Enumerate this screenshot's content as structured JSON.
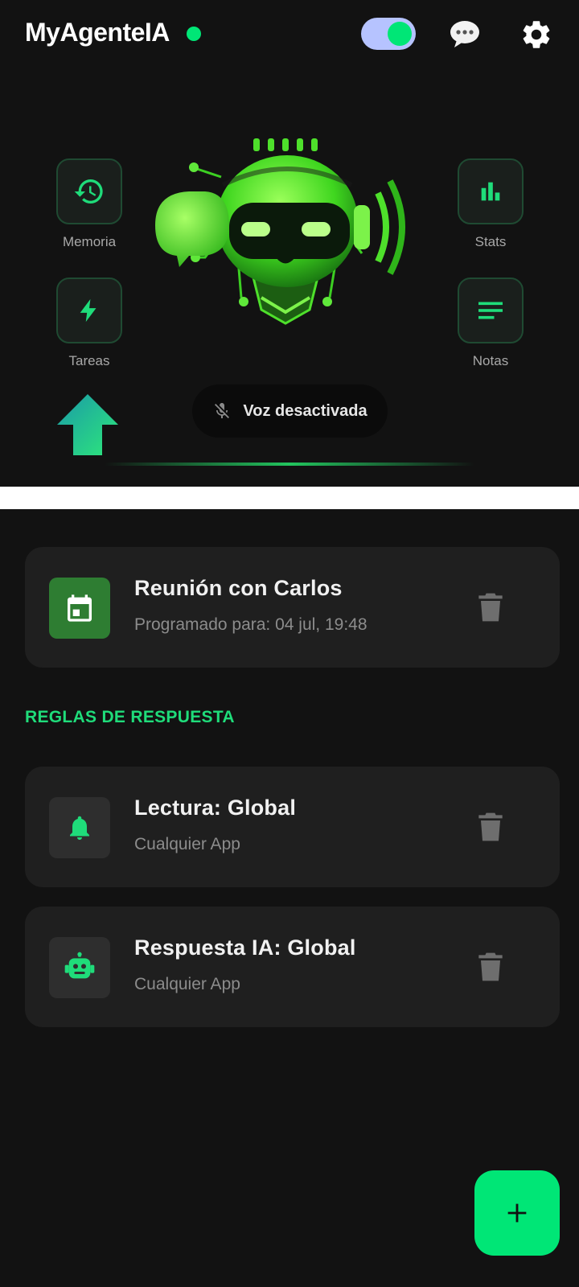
{
  "header": {
    "title": "MyAgenteIA",
    "status": "online",
    "toggle_on": true
  },
  "quick_actions": [
    {
      "label": "Memoria",
      "icon": "history-icon"
    },
    {
      "label": "Tareas",
      "icon": "bolt-icon"
    },
    {
      "label": "Stats",
      "icon": "bar-chart-icon"
    },
    {
      "label": "Notas",
      "icon": "notes-icon"
    }
  ],
  "voice": {
    "label": "Voz desactivada",
    "icon": "mic-off-icon"
  },
  "scheduled": {
    "title": "Reunión con Carlos",
    "subtitle": "Programado para: 04 jul, 19:48",
    "icon": "calendar-icon"
  },
  "rules_heading": "REGLAS DE RESPUESTA",
  "rules": [
    {
      "title": "Lectura: Global",
      "subtitle": "Cualquier App",
      "icon": "bell-icon"
    },
    {
      "title": "Respuesta IA: Global",
      "subtitle": "Cualquier App",
      "icon": "robot-icon"
    }
  ],
  "colors": {
    "accent": "#00e676",
    "background": "#121212",
    "card": "#1f1f1f"
  }
}
